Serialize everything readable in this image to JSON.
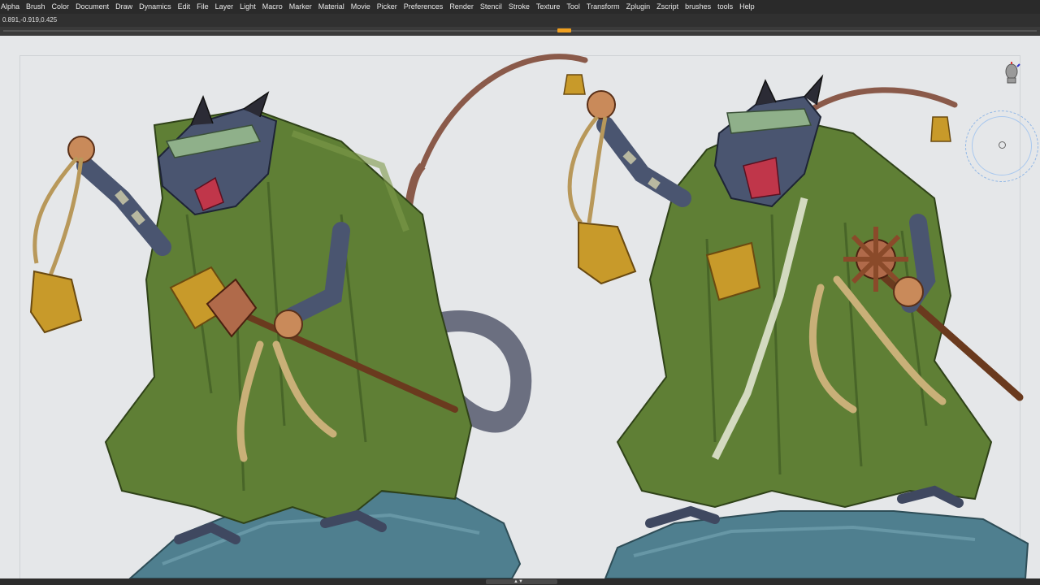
{
  "app": {
    "menu": [
      "Alpha",
      "Brush",
      "Color",
      "Document",
      "Draw",
      "Dynamics",
      "Edit",
      "File",
      "Layer",
      "Light",
      "Macro",
      "Marker",
      "Material",
      "Movie",
      "Picker",
      "Preferences",
      "Render",
      "Stencil",
      "Stroke",
      "Texture",
      "Tool",
      "Transform",
      "Zplugin",
      "Zscript",
      "brushes",
      "tools",
      "Help"
    ]
  },
  "infobar": {
    "coordinates": "0.891,-0.919,0.425"
  },
  "icons": {
    "gizmo": "head-gizmo-icon",
    "navigation": "rotate-navigation-icon",
    "bottom_handle": "expand-arrows-icon"
  },
  "colors": {
    "menubar_bg": "#2a2a2a",
    "viewport_bg": "#e5e7e9",
    "timeline_marker": "#f0a020",
    "robe_green": "#5f7f35",
    "bell_gold": "#c89a2a",
    "rock_blue": "#4f7f8f"
  }
}
